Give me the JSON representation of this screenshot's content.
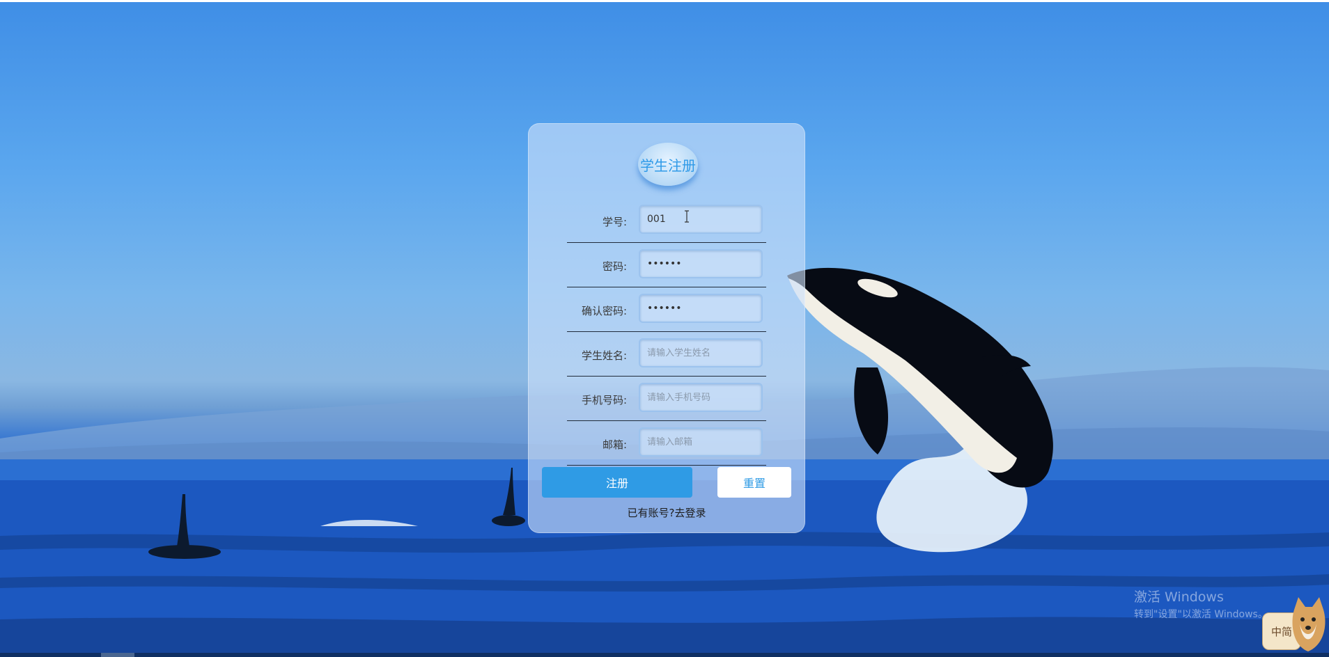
{
  "form": {
    "title": "学生注册",
    "fields": [
      {
        "label": "学号:",
        "value": "001",
        "placeholder": "",
        "type": "text"
      },
      {
        "label": "密码:",
        "value": "123456",
        "placeholder": "",
        "type": "password"
      },
      {
        "label": "确认密码:",
        "value": "123456",
        "placeholder": "",
        "type": "password"
      },
      {
        "label": "学生姓名:",
        "value": "",
        "placeholder": "请输入学生姓名",
        "type": "text"
      },
      {
        "label": "手机号码:",
        "value": "",
        "placeholder": "请输入手机号码",
        "type": "text"
      },
      {
        "label": "邮箱:",
        "value": "",
        "placeholder": "请输入邮箱",
        "type": "text"
      }
    ],
    "register_label": "注册",
    "reset_label": "重置",
    "login_link": "已有账号?去登录"
  },
  "windows_watermark": {
    "line1": "激活 Windows",
    "line2": "转到\"设置\"以激活 Windows。"
  },
  "ime": {
    "label": "中简"
  },
  "colors": {
    "accent": "#2f9be5",
    "panel": "#cde1fa"
  }
}
